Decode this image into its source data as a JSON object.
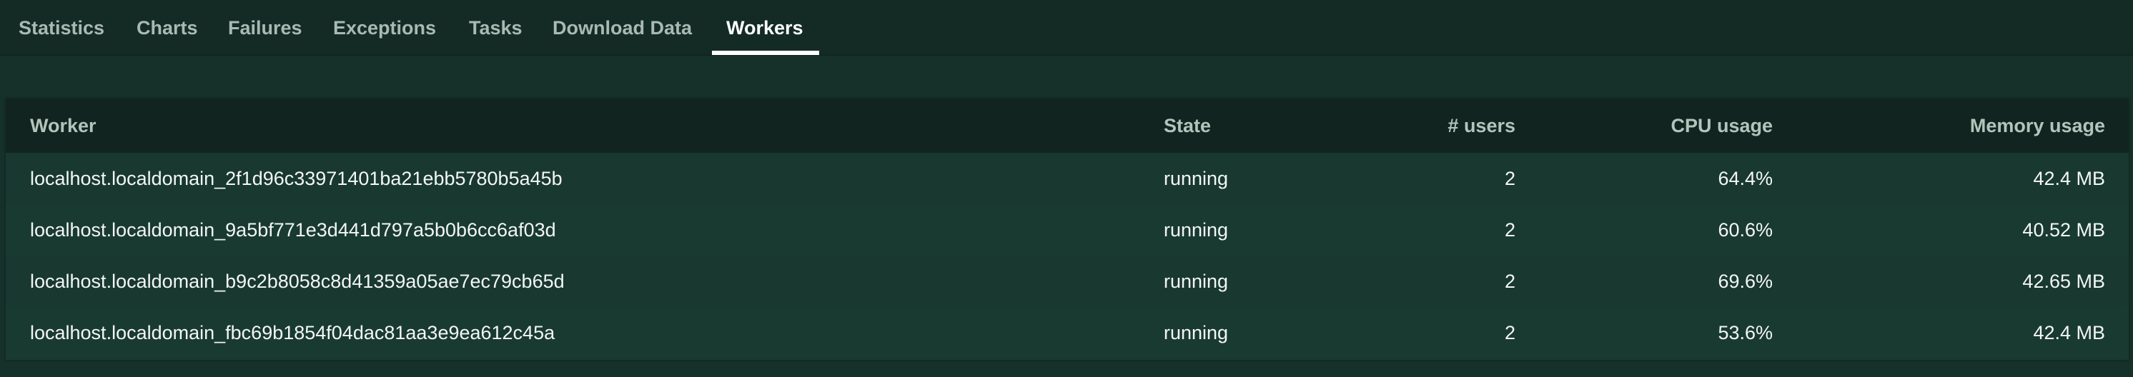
{
  "tabs": [
    {
      "label": "Statistics"
    },
    {
      "label": "Charts"
    },
    {
      "label": "Failures"
    },
    {
      "label": "Exceptions"
    },
    {
      "label": "Tasks"
    },
    {
      "label": "Download Data"
    },
    {
      "label": "Workers",
      "active": true
    }
  ],
  "table": {
    "headers": {
      "worker": "Worker",
      "state": "State",
      "users": "# users",
      "cpu": "CPU usage",
      "memory": "Memory usage"
    },
    "rows": [
      {
        "worker": "localhost.localdomain_2f1d96c33971401ba21ebb5780b5a45b",
        "state": "running",
        "users": "2",
        "cpu": "64.4%",
        "memory": "42.4 MB"
      },
      {
        "worker": "localhost.localdomain_9a5bf771e3d441d797a5b0b6cc6af03d",
        "state": "running",
        "users": "2",
        "cpu": "60.6%",
        "memory": "40.52 MB"
      },
      {
        "worker": "localhost.localdomain_b9c2b8058c8d41359a05ae7ec79cb65d",
        "state": "running",
        "users": "2",
        "cpu": "69.6%",
        "memory": "42.65 MB"
      },
      {
        "worker": "localhost.localdomain_fbc69b1854f04dac81aa3e9ea612c45a",
        "state": "running",
        "users": "2",
        "cpu": "53.6%",
        "memory": "42.4 MB"
      }
    ]
  },
  "colors": {
    "background": "#16302a",
    "header": "#12241f",
    "row": "#183830",
    "active_tab": "#ffffff",
    "inactive_tab": "#a9bab2"
  }
}
